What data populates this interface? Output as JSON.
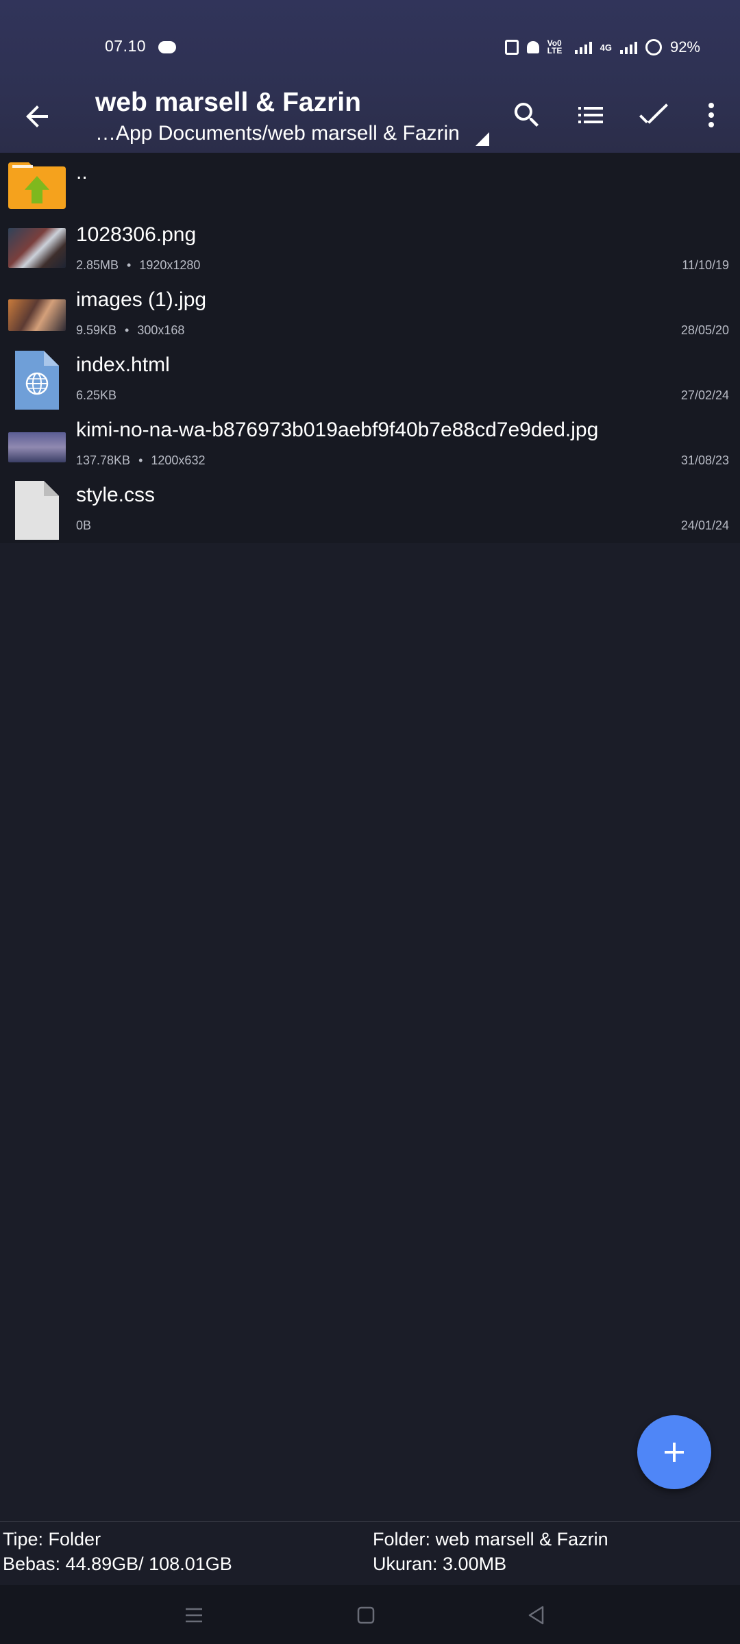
{
  "status_bar": {
    "time": "07.10",
    "volte_label": "Vo0 LTE",
    "network_label": "4G",
    "battery": "92%"
  },
  "app_bar": {
    "title": "web marsell & Fazrin",
    "path": "…App Documents/web marsell & Fazrin"
  },
  "files": [
    {
      "name": "..",
      "size": "",
      "dims": "",
      "date": "",
      "icon": "folder-up-icon"
    },
    {
      "name": "1028306.png",
      "size": "2.85MB",
      "dims": "1920x1280",
      "date": "11/10/19",
      "icon": "image-thumbnail"
    },
    {
      "name": "images (1).jpg",
      "size": "9.59KB",
      "dims": "300x168",
      "date": "28/05/20",
      "icon": "image-thumbnail"
    },
    {
      "name": "index.html",
      "size": "6.25KB",
      "dims": "",
      "date": "27/02/24",
      "icon": "html-file-icon"
    },
    {
      "name": "kimi-no-na-wa-b876973b019aebf9f40b7e88cd7e9ded.jpg",
      "size": "137.78KB",
      "dims": "1200x632",
      "date": "31/08/23",
      "icon": "image-thumbnail"
    },
    {
      "name": "style.css",
      "size": "0B",
      "dims": "",
      "date": "24/01/24",
      "icon": "generic-file-icon"
    }
  ],
  "info_bar": {
    "type": "Tipe: Folder",
    "free": "Bebas: 44.89GB/ 108.01GB",
    "folder": "Folder: web marsell & Fazrin",
    "size": "Ukuran: 3.00MB"
  },
  "colors": {
    "header": "#2e3152",
    "background": "#1b1d28",
    "list_background": "#171922",
    "fab": "#4f86f7",
    "folder": "#f5a21d",
    "folder_arrow": "#7fb81e"
  }
}
